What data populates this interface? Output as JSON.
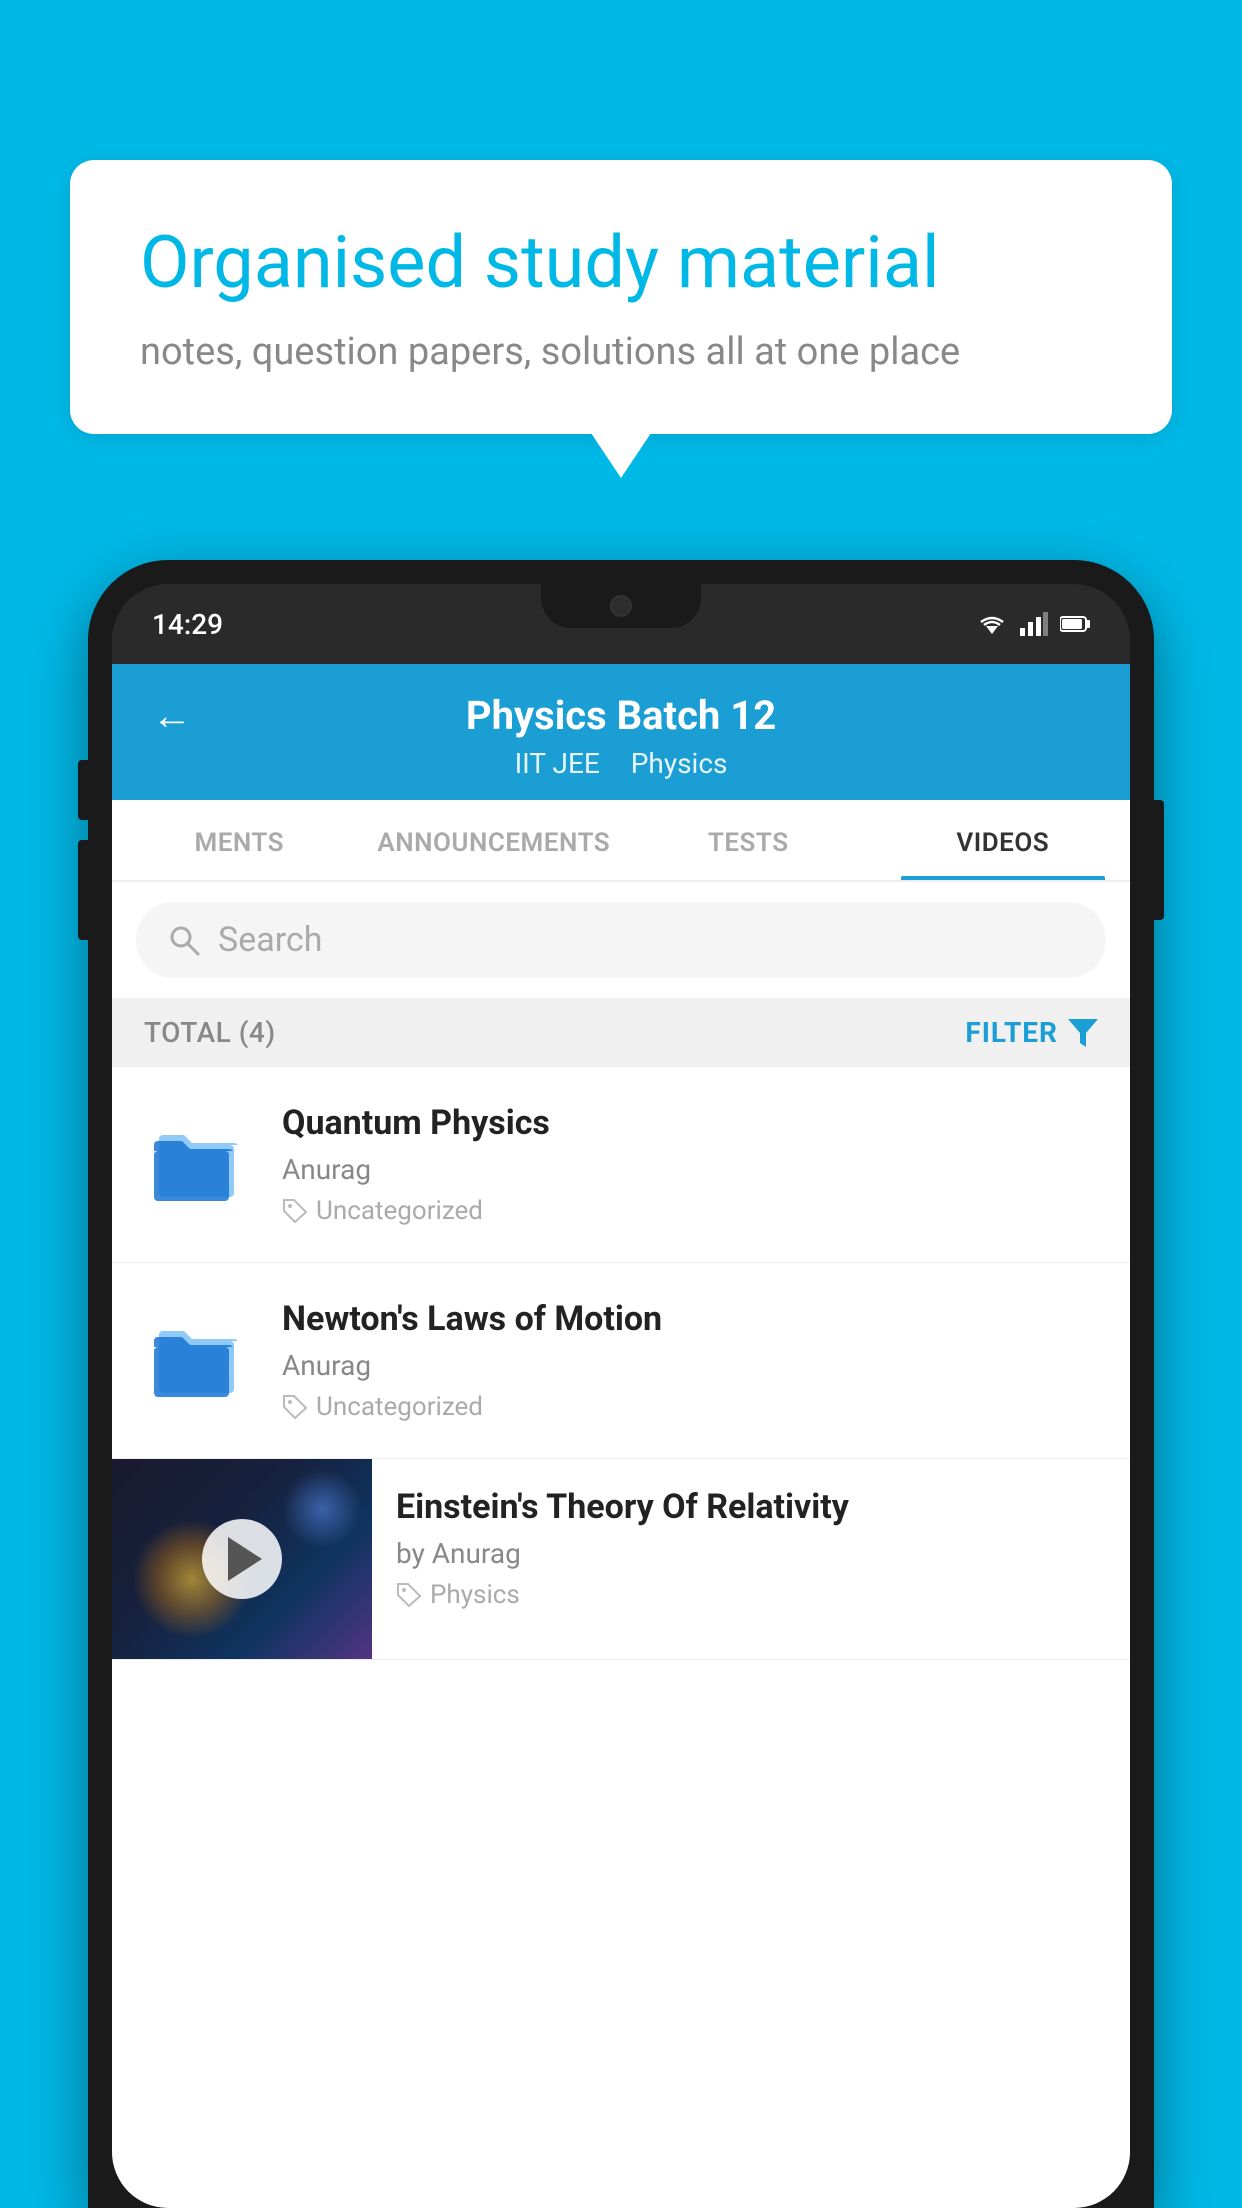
{
  "background_color": "#00b8e6",
  "speech_bubble": {
    "title": "Organised study material",
    "subtitle": "notes, question papers, solutions all at one place"
  },
  "phone": {
    "time": "14:29",
    "status_icons": [
      "wifi",
      "signal",
      "battery"
    ]
  },
  "app": {
    "header": {
      "back_label": "←",
      "title": "Physics Batch 12",
      "subtitle_1": "IIT JEE",
      "subtitle_2": "Physics"
    },
    "tabs": [
      {
        "label": "MENTS",
        "active": false
      },
      {
        "label": "ANNOUNCEMENTS",
        "active": false
      },
      {
        "label": "TESTS",
        "active": false
      },
      {
        "label": "VIDEOS",
        "active": true
      }
    ],
    "search": {
      "placeholder": "Search"
    },
    "filter_bar": {
      "total_label": "TOTAL (4)",
      "filter_label": "FILTER"
    },
    "videos": [
      {
        "title": "Quantum Physics",
        "author": "Anurag",
        "tag": "Uncategorized",
        "type": "folder"
      },
      {
        "title": "Newton's Laws of Motion",
        "author": "Anurag",
        "tag": "Uncategorized",
        "type": "folder"
      },
      {
        "title": "Einstein's Theory Of Relativity",
        "author": "by Anurag",
        "tag": "Physics",
        "type": "video"
      }
    ]
  }
}
